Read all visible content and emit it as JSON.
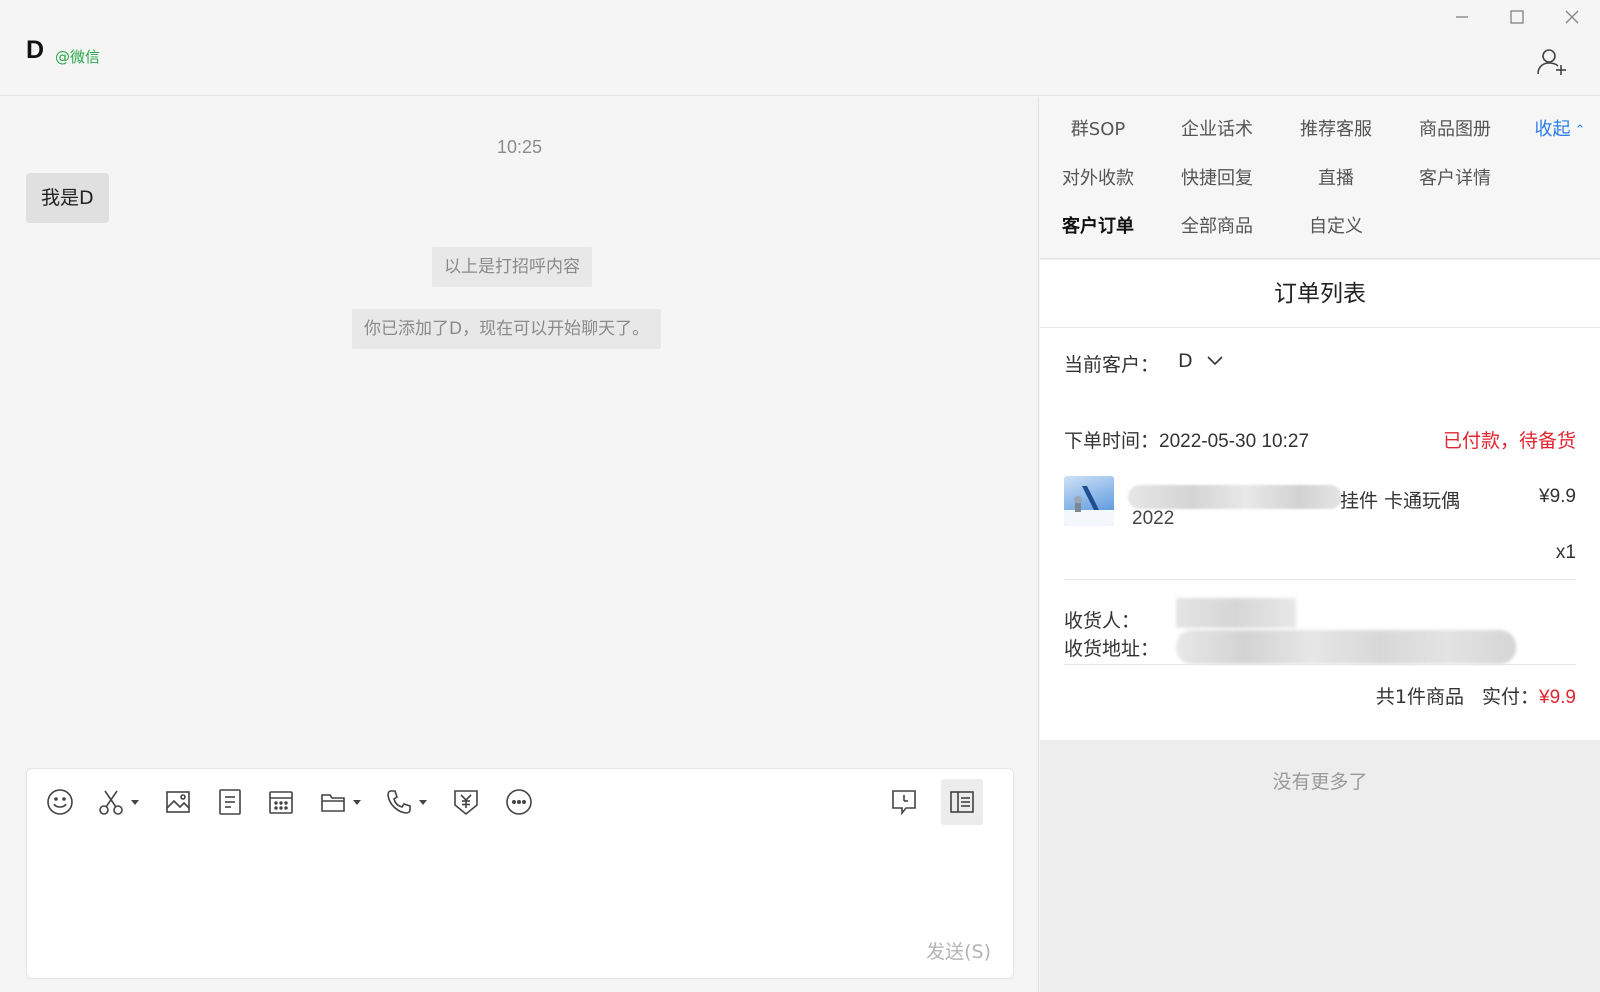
{
  "header": {
    "contact_name": "D",
    "contact_source": "@微信"
  },
  "chat": {
    "time": "10:25",
    "message": "我是D",
    "system_messages": [
      "以上是打招呼内容",
      "你已添加了D，现在可以开始聊天了。"
    ]
  },
  "input": {
    "send_label": "发送(S)",
    "tools": [
      "emoji-icon",
      "scissors-icon",
      "image-icon",
      "document-icon",
      "calendar-icon",
      "folder-icon",
      "phone-icon",
      "payment-icon",
      "more-icon",
      "chat-history-icon",
      "sidebar-icon"
    ]
  },
  "panel": {
    "tabs": {
      "group_sop": "群SOP",
      "scripts": "企业话术",
      "recommend_service": "推荐客服",
      "product_album": "商品图册",
      "collapse": "收起",
      "external_payment": "对外收款",
      "quick_reply": "快捷回复",
      "live": "直播",
      "customer_detail": "客户详情",
      "customer_orders": "客户订单",
      "all_products": "全部商品",
      "custom": "自定义"
    },
    "orders": {
      "title": "订单列表",
      "current_customer_label": "当前客户：",
      "current_customer_value": "D",
      "order_time": "下单时间：2022-05-30 10:27",
      "status": "已付款，待备货",
      "product_name": "挂件 卡通玩偶",
      "product_year": "2022",
      "product_price": "¥9.9",
      "product_qty": "x1",
      "receiver_label": "收货人：",
      "address_label": "收货地址：",
      "summary_count": "共1件商品",
      "summary_paid_label": "实付：",
      "summary_paid_value": "¥9.9"
    },
    "no_more": "没有更多了"
  },
  "colors": {
    "accent_blue": "#2b7de9",
    "status_red": "#e0262f",
    "source_green": "#2aa84a"
  }
}
